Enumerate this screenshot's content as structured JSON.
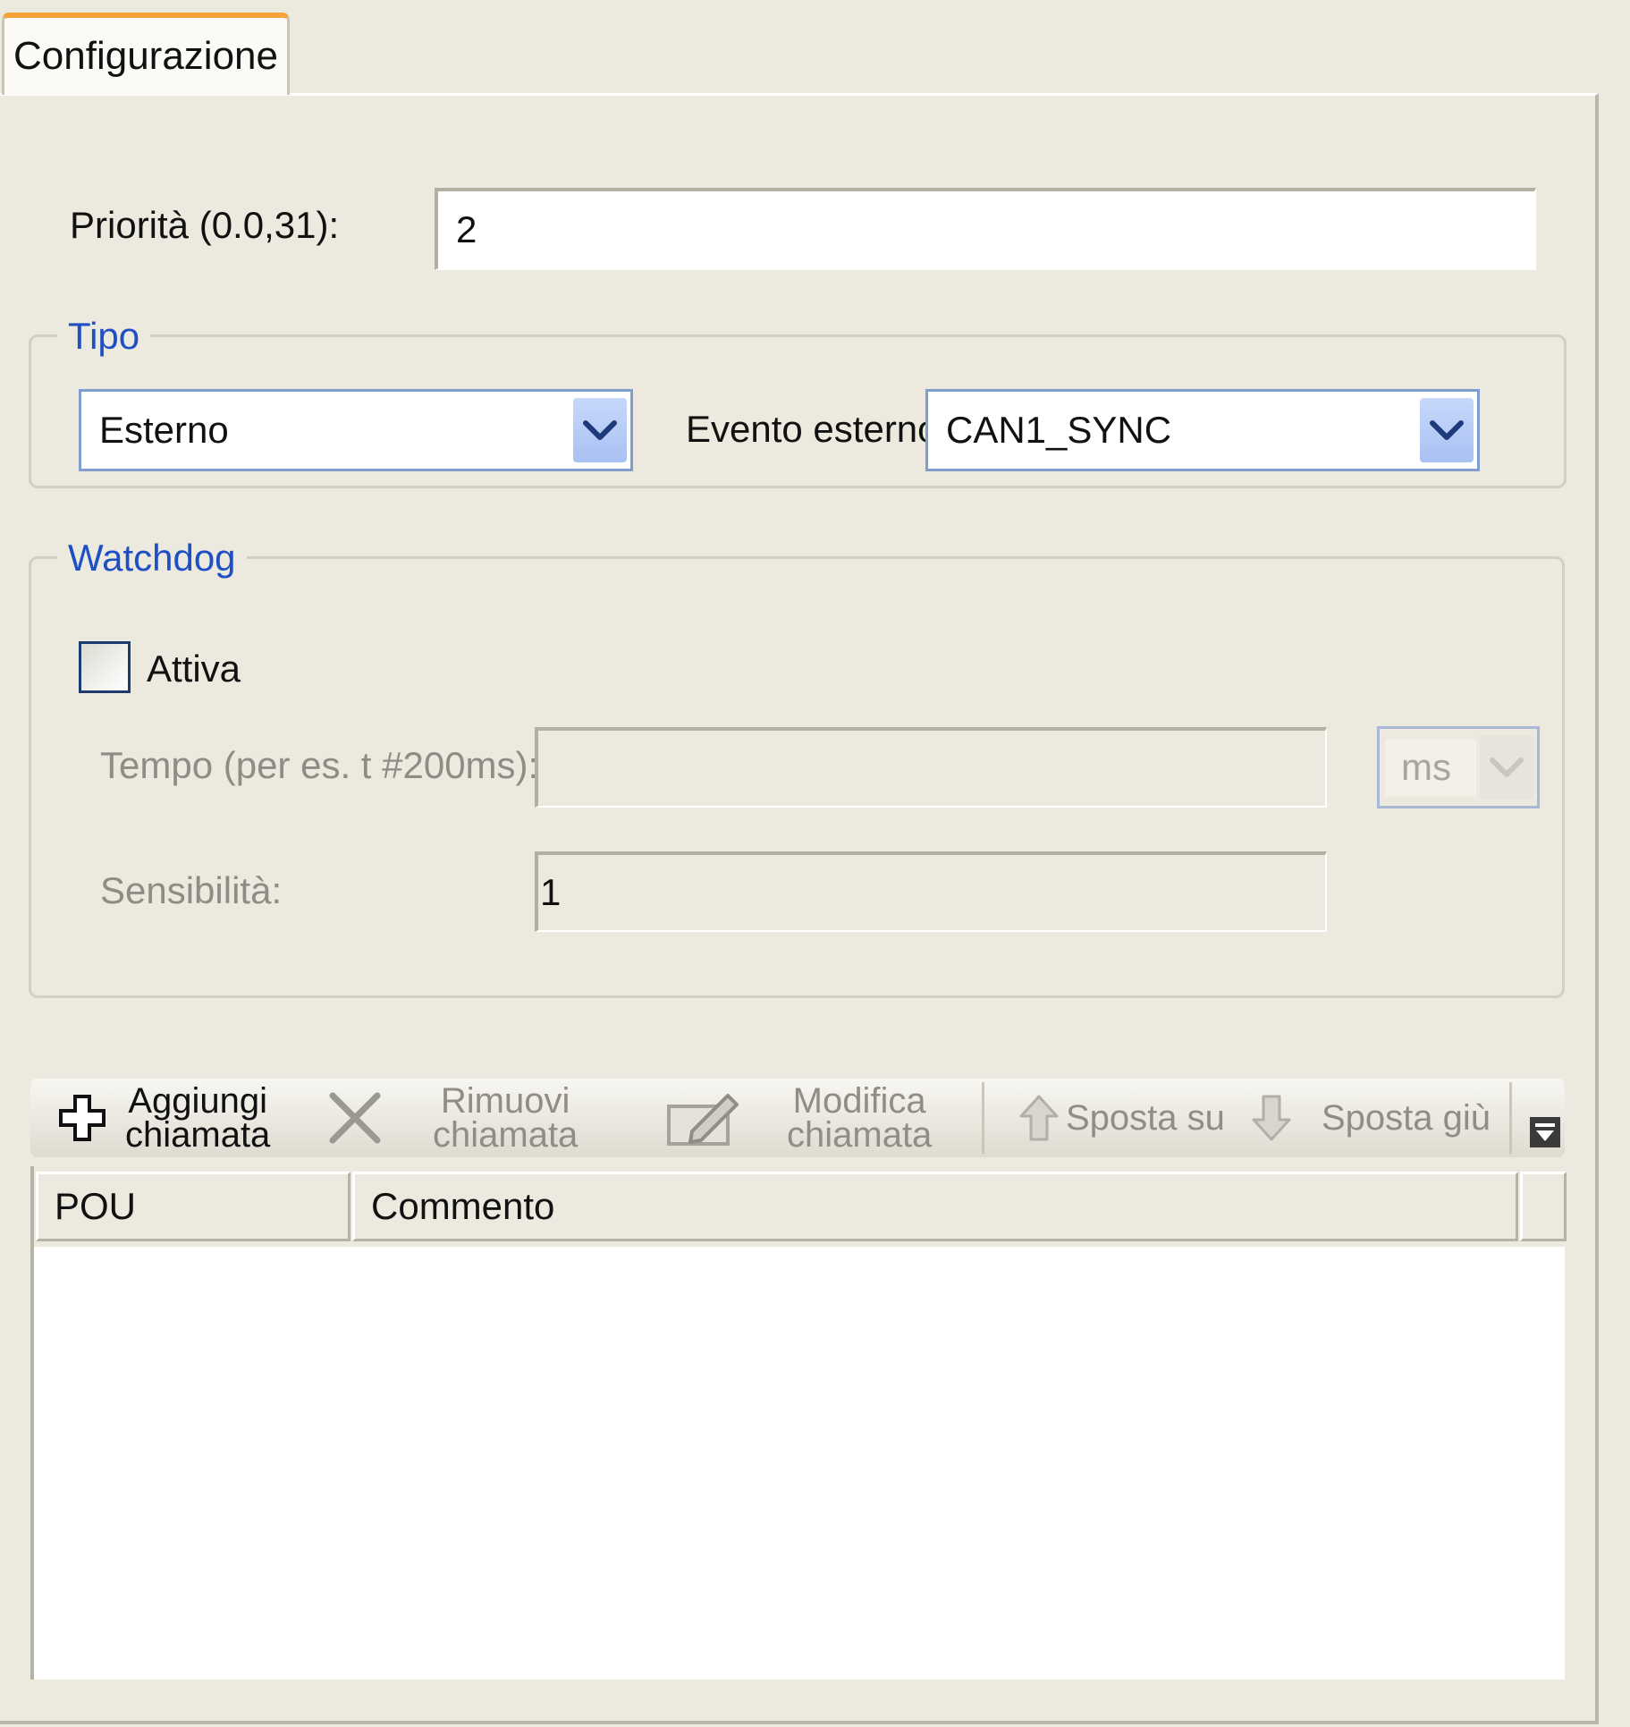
{
  "tab": {
    "label": "Configurazione"
  },
  "priority": {
    "label": "Priorità (0.0,31):",
    "value": "2"
  },
  "tipo": {
    "title": "Tipo",
    "type_value": "Esterno",
    "event_label": "Evento esterno:",
    "event_value": "CAN1_SYNC"
  },
  "watchdog": {
    "title": "Watchdog",
    "enable_label": "Attiva",
    "enabled": false,
    "time_label": "Tempo (per es. t #200ms):",
    "time_value": "",
    "time_unit": "ms",
    "sensitivity_label": "Sensibilità:",
    "sensitivity_value": "1"
  },
  "toolbar": {
    "add_line1": "Aggiungi",
    "add_line2": "chiamata",
    "remove_line1": "Rimuovi",
    "remove_line2": "chiamata",
    "edit_line1": "Modifica",
    "edit_line2": "chiamata",
    "move_up": "Sposta su",
    "move_down": "Sposta giù"
  },
  "table": {
    "columns": [
      "POU",
      "Commento"
    ],
    "rows": []
  },
  "colors": {
    "accent_tab": "#f3a338",
    "group_title": "#1f4fc4",
    "combo_border": "#7f9dcf",
    "background": "#ece9de"
  }
}
